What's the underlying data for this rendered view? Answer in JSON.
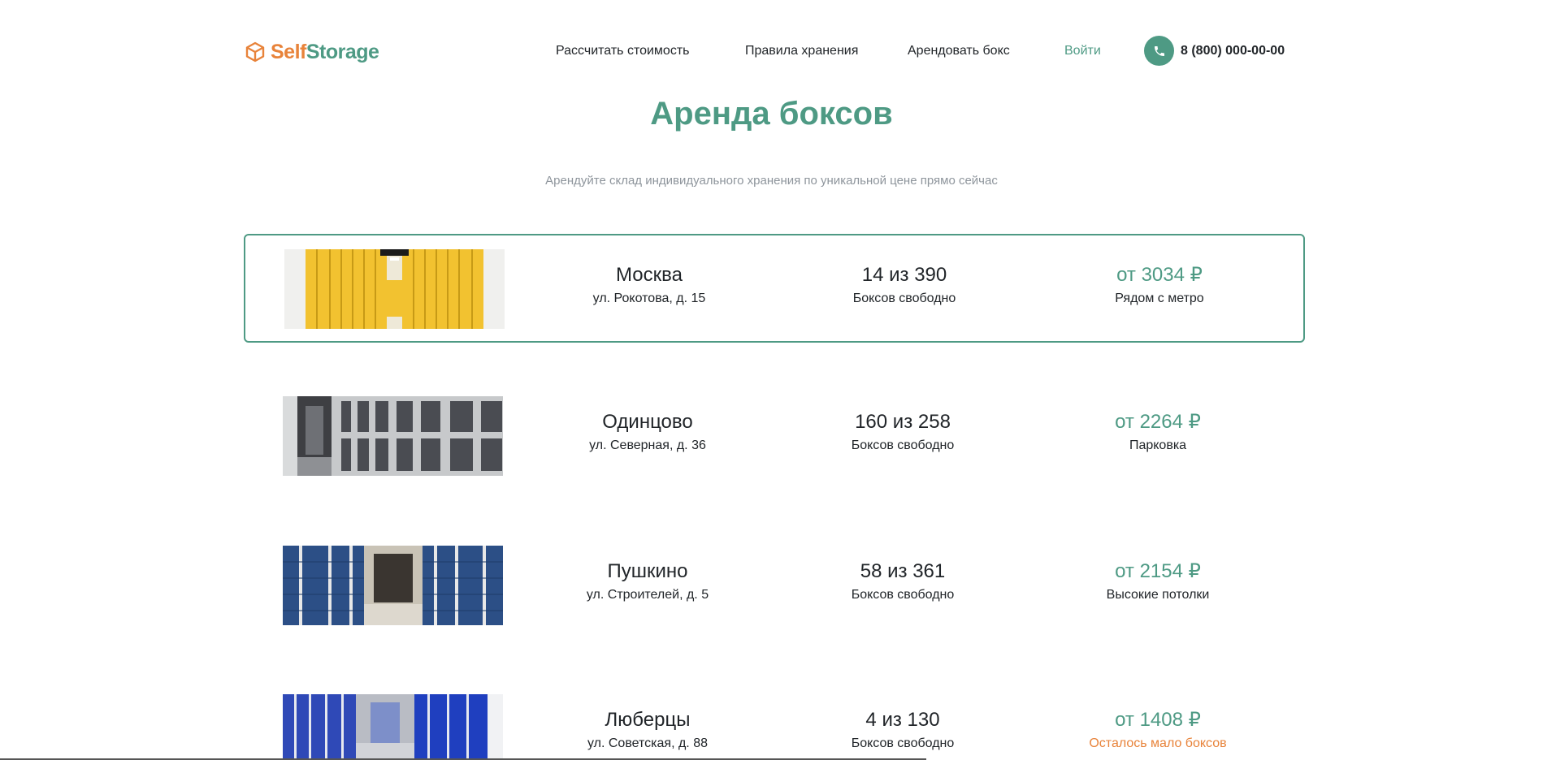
{
  "header": {
    "logo_self": "Self",
    "logo_storage": "Storage",
    "nav": [
      {
        "label": "Рассчитать стоимость"
      },
      {
        "label": "Правила хранения"
      },
      {
        "label": "Арендовать бокс"
      },
      {
        "label": "Войти"
      }
    ],
    "phone": "8 (800) 000-00-00"
  },
  "page": {
    "title": "Аренда боксов",
    "subtitle": "Арендуйте склад индивидуального хранения по уникальной цене прямо сейчас"
  },
  "warehouses": [
    {
      "city": "Москва",
      "address": "ул. Рокотова, д. 15",
      "availability": "14 из 390",
      "availability_label": "Боксов свободно",
      "price": "от 3034 ₽",
      "feature": "Рядом с метро",
      "image": "yellow-storage-corridor",
      "selected": true
    },
    {
      "city": "Одинцово",
      "address": "ул. Северная, д. 36",
      "availability": "160 из 258",
      "availability_label": "Боксов свободно",
      "price": "от 2264 ₽",
      "feature": "Парковка",
      "image": "gray-storage-corridor",
      "selected": false
    },
    {
      "city": "Пушкино",
      "address": "ул. Строителей, д. 5",
      "availability": "58 из 361",
      "availability_label": "Боксов свободно",
      "price": "от 2154 ₽",
      "feature": "Высокие потолки",
      "image": "blue-storage-corridor",
      "selected": false
    },
    {
      "city": "Люберцы",
      "address": "ул. Советская, д. 88",
      "availability": "4 из 130",
      "availability_label": "Боксов свободно",
      "price": "от 1408 ₽",
      "feature": "Осталось мало боксов",
      "image": "blue-storage-hall",
      "selected": false
    }
  ],
  "colors": {
    "brand": "#4e9a84",
    "accent": "#e8833a",
    "muted": "#8e959c"
  }
}
